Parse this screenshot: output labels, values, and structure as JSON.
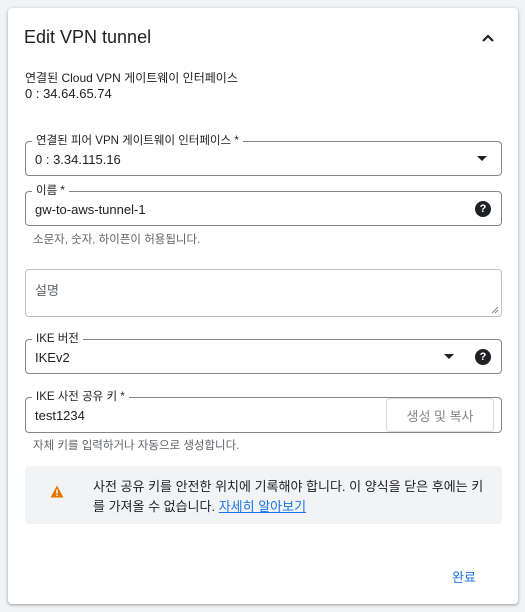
{
  "header": {
    "title": "Edit VPN tunnel"
  },
  "gateway": {
    "label": "연결된 Cloud VPN 게이트웨이 인터페이스",
    "value": "0 : 34.64.65.74"
  },
  "peer_interface": {
    "label": "연결된 피어 VPN 게이트웨이 인터페이스 *",
    "value": "0 : 3.34.115.16"
  },
  "name": {
    "label": "이름 *",
    "value": "gw-to-aws-tunnel-1",
    "hint": "소문자, 숫자, 하이픈이 허용됩니다."
  },
  "description": {
    "placeholder": "설명"
  },
  "ike_version": {
    "label": "IKE 버전",
    "value": "IKEv2"
  },
  "psk": {
    "label": "IKE 사전 공유 키 *",
    "value": "test1234",
    "generate_label": "생성 및 복사",
    "hint": "자체 키를 입력하거나 자동으로 생성합니다."
  },
  "warning": {
    "text": "사전 공유 키를 안전한 위치에 기록해야 합니다. 이 양식을 닫은 후에는 키를 가져올 수 없습니다. ",
    "link": "자세히 알아보기"
  },
  "footer": {
    "done_label": "완료"
  },
  "colors": {
    "accent": "#1a73e8",
    "warning": "#e37400",
    "text": "#202124"
  }
}
